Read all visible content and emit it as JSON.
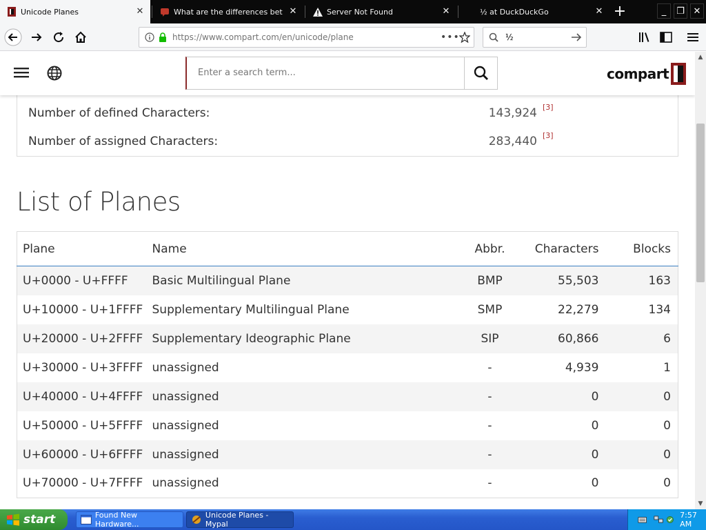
{
  "browser": {
    "tabs": [
      {
        "title": "Unicode Planes",
        "active": true
      },
      {
        "title": "What are the differences betwee",
        "active": false
      },
      {
        "title": "Server Not Found",
        "active": false
      },
      {
        "title": "½ at DuckDuckGo",
        "active": false
      }
    ],
    "url_host": "https://www.compart.com",
    "url_path": "/en/unicode/plane",
    "search_value": "½"
  },
  "site": {
    "search_placeholder": "Enter a search term...",
    "logo_text": "compart"
  },
  "stats": [
    {
      "label": "Number of defined Characters:",
      "value": "143,924",
      "ref": "[3]"
    },
    {
      "label": "Number of assigned Characters:",
      "value": "283,440",
      "ref": "[3]"
    }
  ],
  "list_title": "List of Planes",
  "table": {
    "headers": [
      "Plane",
      "Name",
      "Abbr.",
      "Characters",
      "Blocks"
    ],
    "rows": [
      [
        "U+0000 - U+FFFF",
        "Basic Multilingual Plane",
        "BMP",
        "55,503",
        "163"
      ],
      [
        "U+10000 - U+1FFFF",
        "Supplementary Multilingual Plane",
        "SMP",
        "22,279",
        "134"
      ],
      [
        "U+20000 - U+2FFFF",
        "Supplementary Ideographic Plane",
        "SIP",
        "60,866",
        "6"
      ],
      [
        "U+30000 - U+3FFFF",
        "unassigned",
        "-",
        "4,939",
        "1"
      ],
      [
        "U+40000 - U+4FFFF",
        "unassigned",
        "-",
        "0",
        "0"
      ],
      [
        "U+50000 - U+5FFFF",
        "unassigned",
        "-",
        "0",
        "0"
      ],
      [
        "U+60000 - U+6FFFF",
        "unassigned",
        "-",
        "0",
        "0"
      ],
      [
        "U+70000 - U+7FFFF",
        "unassigned",
        "-",
        "0",
        "0"
      ]
    ]
  },
  "taskbar": {
    "start_label": "start",
    "items": [
      "Found New Hardware...",
      "Unicode Planes - Mypal"
    ],
    "clock": "7:57 AM"
  },
  "colors": {
    "accent_red": "#b03030",
    "table_header_rule": "#3a7fc1",
    "taskbar_blue": "#2456c8",
    "start_green": "#2f8b2f"
  }
}
